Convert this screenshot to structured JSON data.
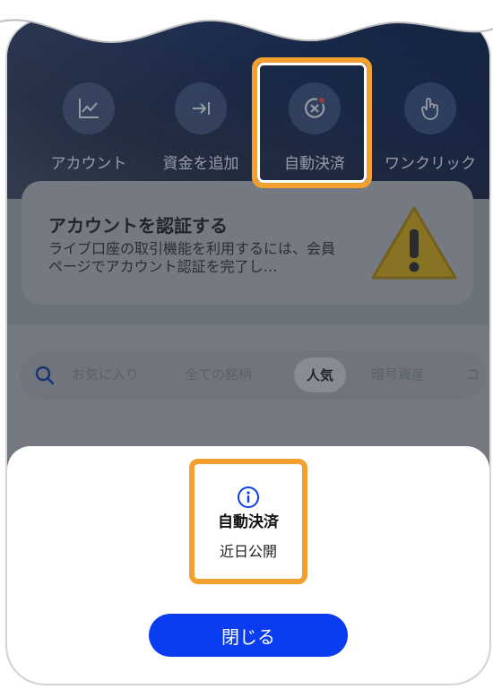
{
  "actions": [
    {
      "label": "アカウント",
      "icon": "chart-line-icon"
    },
    {
      "label": "資金を追加",
      "icon": "arrow-right-bar-icon"
    },
    {
      "label": "自動決済",
      "icon": "auto-settle-icon"
    },
    {
      "label": "ワンクリック",
      "icon": "tap-hand-icon"
    }
  ],
  "verify_card": {
    "title": "アカウントを認証する",
    "text": "ライブ口座の取引機能を利用するには、会員ページでアカウント認証を完了し…",
    "icon": "warning-icon"
  },
  "tabs": {
    "items": [
      "お気に入り",
      "全ての銘柄",
      "人気",
      "暗号資産",
      "コ"
    ],
    "active": "人気"
  },
  "popup": {
    "icon": "info-icon",
    "title": "自動決済",
    "text": "近日公開"
  },
  "close_button": {
    "label": "閉じる"
  },
  "colors": {
    "highlight": "#f2a030",
    "primary_button": "#0a3cf0"
  }
}
